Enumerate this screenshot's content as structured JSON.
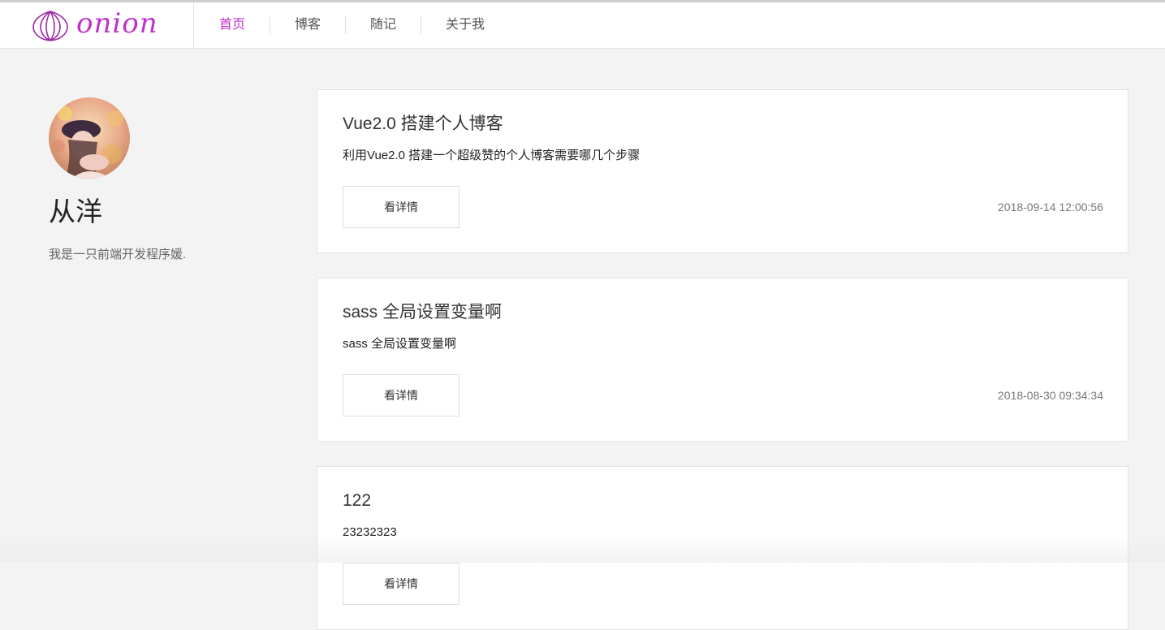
{
  "brand": {
    "name": "onion",
    "logo_icon": "onion-icon",
    "accent": "#c02fc9"
  },
  "nav": {
    "items": [
      {
        "label": "首页",
        "active": true
      },
      {
        "label": "博客",
        "active": false
      },
      {
        "label": "随记",
        "active": false
      },
      {
        "label": "关于我",
        "active": false
      }
    ]
  },
  "profile": {
    "avatar_icon": "avatar",
    "name": "从洋",
    "bio": "我是一只前端开发程序媛."
  },
  "posts": [
    {
      "title": "Vue2.0 搭建个人博客",
      "summary": "利用Vue2.0 搭建一个超级赞的个人博客需要哪几个步骤",
      "button": "看详情",
      "date": "2018-09-14 12:00:56"
    },
    {
      "title": "sass 全局设置变量啊",
      "summary": "sass 全局设置变量啊",
      "button": "看详情",
      "date": "2018-08-30 09:34:34"
    },
    {
      "title": "122",
      "summary": "23232323",
      "button": "看详情",
      "date": ""
    }
  ]
}
